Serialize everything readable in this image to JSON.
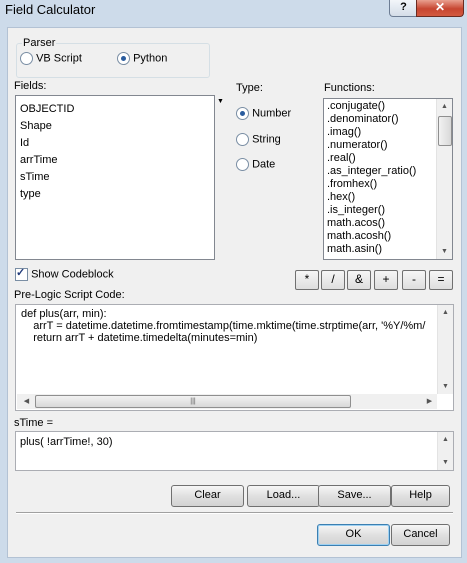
{
  "window": {
    "title": "Field Calculator",
    "help_glyph": "?",
    "close_glyph": "✕"
  },
  "parser": {
    "label": "Parser",
    "options": [
      {
        "label": "VB Script",
        "selected": false
      },
      {
        "label": "Python",
        "selected": true
      }
    ]
  },
  "fields": {
    "label": "Fields:",
    "items": [
      "OBJECTID",
      "Shape",
      "Id",
      "arrTime",
      "sTime",
      "type"
    ]
  },
  "type": {
    "label": "Type:",
    "options": [
      {
        "label": "Number",
        "selected": true
      },
      {
        "label": "String",
        "selected": false
      },
      {
        "label": "Date",
        "selected": false
      }
    ]
  },
  "functions": {
    "label": "Functions:",
    "items": [
      ".conjugate()",
      ".denominator()",
      ".imag()",
      ".numerator()",
      ".real()",
      ".as_integer_ratio()",
      ".fromhex()",
      ".hex()",
      ".is_integer()",
      "math.acos()",
      "math.acosh()",
      "math.asin()"
    ]
  },
  "codeblock": {
    "checkbox_label": "Show Codeblock",
    "checked": true
  },
  "operators": [
    "*",
    "/",
    "&",
    "+",
    "-",
    "="
  ],
  "prelogic": {
    "label": "Pre-Logic Script Code:",
    "lines": [
      "def plus(arr, min):",
      "    arrT = datetime.datetime.fromtimestamp(time.mktime(time.strptime(arr, '%Y/%m/",
      "    return arrT + datetime.timedelta(minutes=min)"
    ]
  },
  "expression": {
    "label": "sTime =",
    "value": "plus( !arrTime!, 30)"
  },
  "buttons": {
    "clear": "Clear",
    "load": "Load...",
    "save": "Save...",
    "help": "Help",
    "ok": "OK",
    "cancel": "Cancel"
  },
  "colors": {
    "frame": "#cddbea",
    "close_button": "#c74631",
    "selected_radio": "#2a5c9e"
  }
}
